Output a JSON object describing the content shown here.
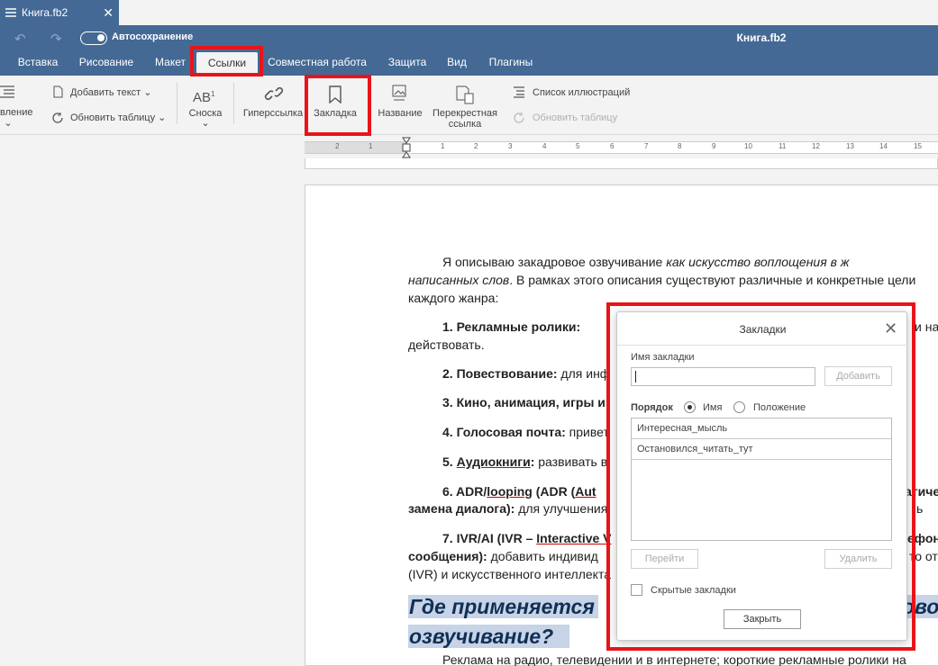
{
  "tab": {
    "filename": "Книга.fb2"
  },
  "header": {
    "autosave_label": "Автосохранение",
    "window_title": "Книга.fb2",
    "menu_tabs": [
      {
        "label": "Вставка"
      },
      {
        "label": "Рисование"
      },
      {
        "label": "Макет"
      },
      {
        "label": "Ссылки"
      },
      {
        "label": "Совместная работа"
      },
      {
        "label": "Защита"
      },
      {
        "label": "Вид"
      },
      {
        "label": "Плагины"
      }
    ],
    "active_tab": "Ссылки"
  },
  "ribbon": {
    "toc_partial": "вление",
    "add_text": "Добавить текст",
    "update_table": "Обновить таблицу",
    "footnote_glyph": "AB",
    "footnote_sup": "1",
    "footnote": "Сноска",
    "hyperlink": "Гиперссылка",
    "bookmark": "Закладка",
    "caption": "Название",
    "cross_ref_1": "Перекрестная",
    "cross_ref_2": "ссылка",
    "figure_list": "Список иллюстраций",
    "update_table_disabled": "Обновить таблицу"
  },
  "ruler": {
    "numbers": [
      "2",
      "1",
      "1",
      "2",
      "3",
      "4",
      "5",
      "6",
      "7",
      "8",
      "9",
      "10",
      "11",
      "12",
      "13",
      "14",
      "15",
      "16"
    ]
  },
  "document": {
    "p1_a": "Я описываю закадровое озвучивание ",
    "p1_a_italic": "как искусство воплощения в ж",
    "p1_b_italic": "написанных слов",
    "p1_b": ". В рамках этого описания существуют различные и конкретные цели",
    "p1_c": "каждого жанра:",
    "l1_bold": "1. Рекламные ролики:",
    "l1_tail": "и на",
    "l1_cont": "действовать.",
    "l2_bold": "2. Повествование:",
    "l2_text": " для инф",
    "l3_bold": "3. Кино, анимация, игры и",
    "l4_bold": "4. Голосовая почта:",
    "l4_text": " привет",
    "l5_num": "5. ",
    "l5_bold": "Аудиокниги",
    "l5_colon": ":",
    "l5_text": " развивать в",
    "l6_a": "6. ADR/",
    "l6_link": "looping",
    "l6_b": " (ADR (",
    "l6_c": "Aut",
    "l6_tail": "атиче",
    "l6_line2_bold": "замена диалога):",
    "l6_line2_text": " для улучшения",
    "l6_line2_tail": "ь",
    "l7_a": "7. IVR/AI (IVR – ",
    "l7_link": "Interactive V",
    "l7_tail": "ефон",
    "l7_line2_bold": "сообщения):",
    "l7_line2_text": " добавить индивид",
    "l7_line2_tail": "то от",
    "l7_line3": "(IVR) и искусственного интеллекта",
    "heading_1a": "Где применяется",
    "heading_1b": "кадровое",
    "heading_2": "озвучивание?",
    "p_last": "Реклама на радио, телевидении и в интернете; короткие рекламные ролики на"
  },
  "dialog": {
    "title": "Закладки",
    "name_label": "Имя закладки",
    "name_value": "",
    "add_button": "Добавить",
    "order_label": "Порядок",
    "sort_name": "Имя",
    "sort_position": "Положение",
    "sort_selected": "Имя",
    "bookmarks": [
      "Интересная_мысль",
      "Остановился_читать_тут"
    ],
    "goto_button": "Перейти",
    "delete_button": "Удалить",
    "hidden_checkbox": "Скрытые закладки",
    "close_button": "Закрыть"
  },
  "colors": {
    "header": "#446995",
    "highlight": "#e8141a",
    "heading": "#0f2f55"
  }
}
